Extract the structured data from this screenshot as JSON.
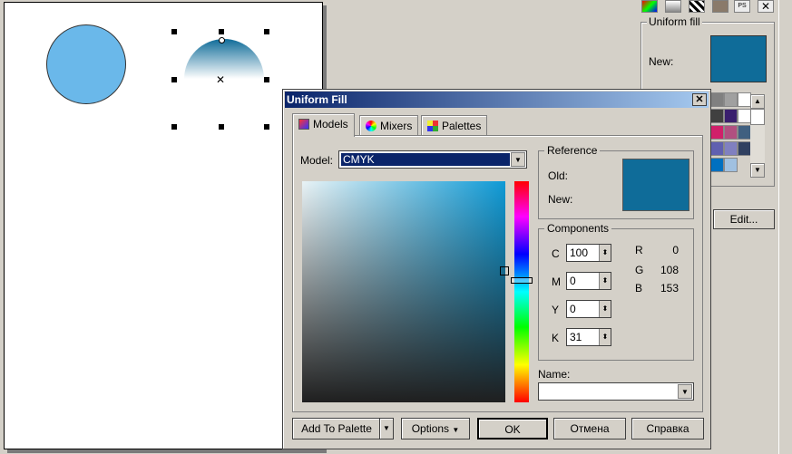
{
  "docker": {
    "group_title": "Uniform fill",
    "new_label": "New:",
    "new_color": "#0f6c99",
    "edit_label": "Edit...",
    "palette_colors": [
      "#808080",
      "#a0a0a0",
      "#ffffff",
      "#404040",
      "#3a1f6e",
      "#ffffff",
      "#d0206a",
      "#b05080",
      "#406080",
      "#6060b0",
      "#8080c0",
      "#304060",
      "#0070c0",
      "#a0c0e0"
    ]
  },
  "canvas": {
    "circle_color": "#6ab8ea",
    "dome_top": "#0f6c99",
    "dome_bottom": "#ffffff"
  },
  "dialog": {
    "title": "Uniform Fill",
    "close_label": "✕",
    "tabs": [
      {
        "label": "Models",
        "icon": "models-icon"
      },
      {
        "label": "Mixers",
        "icon": "mixers-icon"
      },
      {
        "label": "Palettes",
        "icon": "palettes-icon"
      }
    ],
    "model_label": "Model:",
    "model_value": "CMYK",
    "reference": {
      "title": "Reference",
      "old_label": "Old:",
      "new_label": "New:",
      "color": "#0f6c99"
    },
    "components": {
      "title": "Components",
      "cmyk": [
        {
          "label": "C",
          "value": "100"
        },
        {
          "label": "M",
          "value": "0"
        },
        {
          "label": "Y",
          "value": "0"
        },
        {
          "label": "K",
          "value": "31"
        }
      ],
      "rgb": [
        {
          "label": "R",
          "value": "0"
        },
        {
          "label": "G",
          "value": "108"
        },
        {
          "label": "B",
          "value": "153"
        }
      ]
    },
    "name_label": "Name:",
    "name_value": "",
    "buttons": {
      "add_to_palette": "Add To Palette",
      "options": "Options",
      "ok": "OK",
      "cancel": "Отмена",
      "help": "Справка"
    }
  }
}
